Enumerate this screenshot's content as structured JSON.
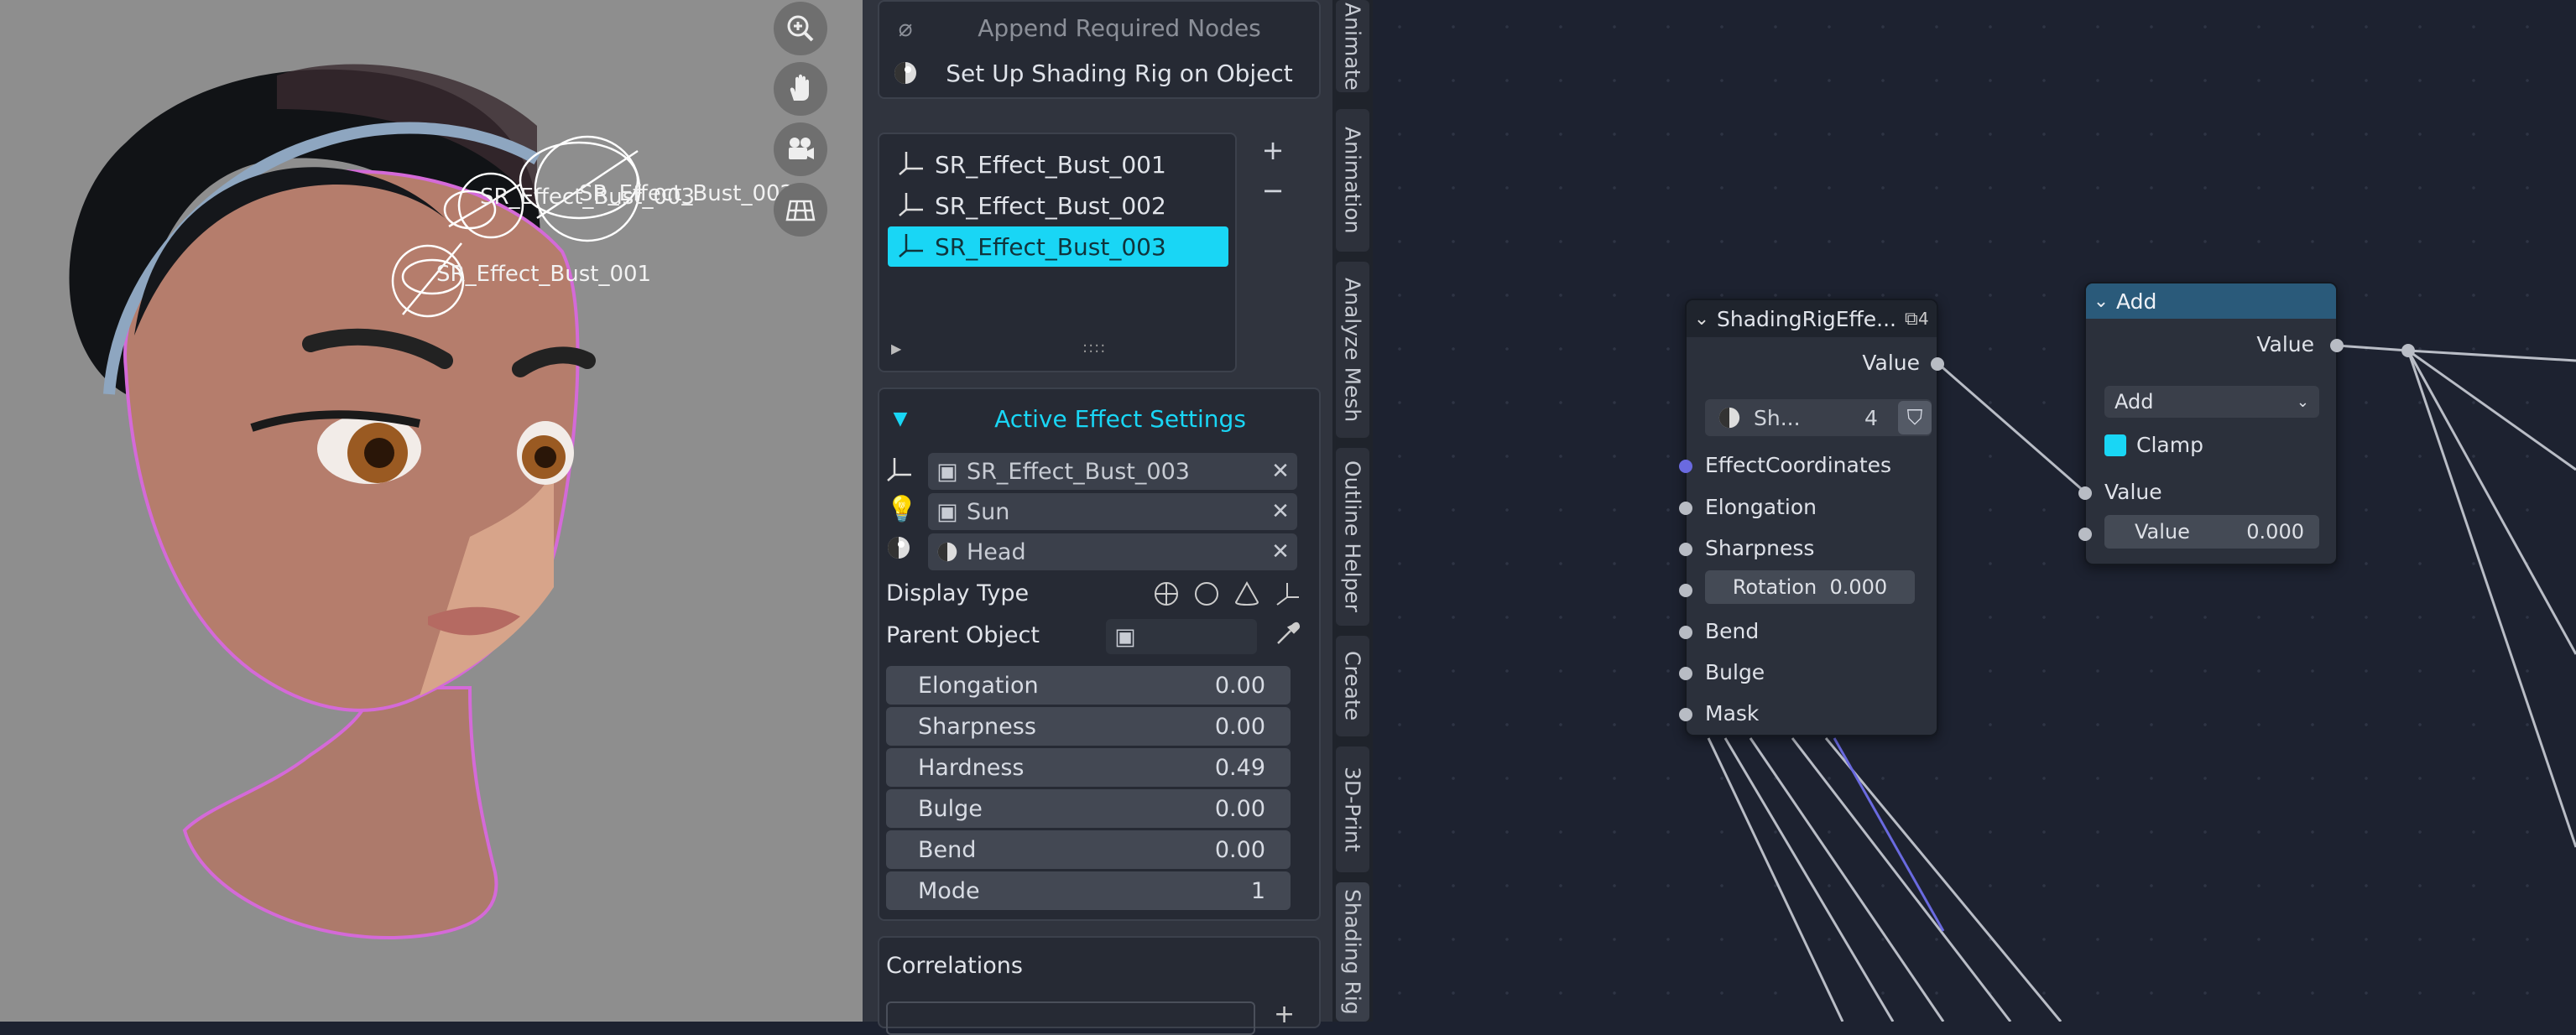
{
  "viewport": {
    "empty_labels": [
      "SR_Effect_Bust_003",
      "SR_Effect_Bust_002",
      "SR_Effect_Bust_001"
    ],
    "nav_icons": [
      "zoom-icon",
      "hand-icon",
      "camera-icon",
      "grid-icon"
    ]
  },
  "panel": {
    "append_label": "Append Required Nodes",
    "setup_label": "Set Up Shading Rig on Object",
    "effects": [
      "SR_Effect_Bust_001",
      "SR_Effect_Bust_002",
      "SR_Effect_Bust_003"
    ],
    "selected_effect": "SR_Effect_Bust_003",
    "add_symbol": "+",
    "remove_symbol": "−",
    "list_grip": "::::",
    "active_header": "Active Effect Settings",
    "effect_object": "SR_Effect_Bust_003",
    "light_object": "Sun",
    "shade_object": "Head",
    "display_type_label": "Display Type",
    "parent_object_label": "Parent Object",
    "sliders": [
      {
        "label": "Elongation",
        "value": "0.00"
      },
      {
        "label": "Sharpness",
        "value": "0.00"
      },
      {
        "label": "Hardness",
        "value": "0.49"
      },
      {
        "label": "Bulge",
        "value": "0.00"
      },
      {
        "label": "Bend",
        "value": "0.00"
      },
      {
        "label": "Mode",
        "value": "1"
      }
    ],
    "correlations_label": "Correlations",
    "accent_color": "#19d6f5"
  },
  "tabs": [
    "Animate",
    "Animation",
    "Analyze Mesh",
    "Outline Helper",
    "Create",
    "3D-Print",
    "Shading Rig"
  ],
  "node_group": {
    "title": "ShadingRigEffe...",
    "user_count": "4",
    "output_label": "Value",
    "datablock_name": "Sh...",
    "datablock_users": "4",
    "inputs": [
      "EffectCoordinates",
      "Elongation",
      "Sharpness",
      "Bend",
      "Bulge",
      "Mask"
    ],
    "rotation_label": "Rotation",
    "rotation_value": "0.000"
  },
  "node_add": {
    "title": "Add",
    "output_label": "Value",
    "operation": "Add",
    "clamp_label": "Clamp",
    "input_label": "Value",
    "value_label": "Value",
    "value": "0.000",
    "header_color": "#2a5a7a"
  }
}
